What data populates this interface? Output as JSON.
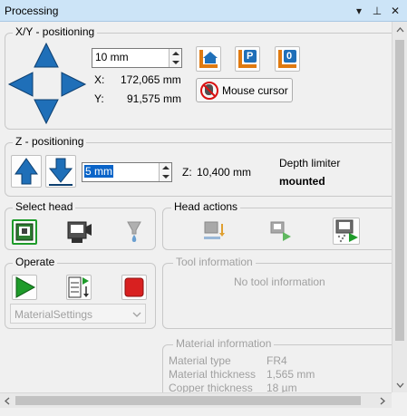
{
  "panel": {
    "title": "Processing",
    "dropdown_glyph": "▾",
    "pin_glyph": "⊥",
    "close_glyph": "✕"
  },
  "xy": {
    "title": "X/Y - positioning",
    "step_value": "10 mm",
    "x_label": "X:",
    "x_value": "172,065 mm",
    "y_label": "Y:",
    "y_value": "91,575 mm",
    "home_icon": "home-icon",
    "park_label": "P",
    "origin_label": "0",
    "mouse_cursor_label": "Mouse cursor"
  },
  "z": {
    "title": "Z - positioning",
    "step_value": "5 mm",
    "z_label": "Z:",
    "z_value": "10,400 mm",
    "depth_limiter_label": "Depth limiter",
    "depth_limiter_state": "mounted"
  },
  "select_head": {
    "title": "Select head"
  },
  "head_actions": {
    "title": "Head actions"
  },
  "operate": {
    "title": "Operate",
    "dropdown_value": "MaterialSettings"
  },
  "tool_info": {
    "title": "Tool information",
    "message": "No tool information"
  },
  "material_info": {
    "title": "Material information",
    "rows": [
      {
        "label": "Material type",
        "value": "FR4"
      },
      {
        "label": "Material thickness",
        "value": "1,565 mm"
      },
      {
        "label": "Copper thickness",
        "value": "18 µm"
      }
    ]
  },
  "colors": {
    "title_bar": "#cce4f7",
    "arrow_blue": "#1f6fb8",
    "play_green": "#1e9b2a",
    "stop_red": "#d82020",
    "selection": "#0a64c8"
  }
}
